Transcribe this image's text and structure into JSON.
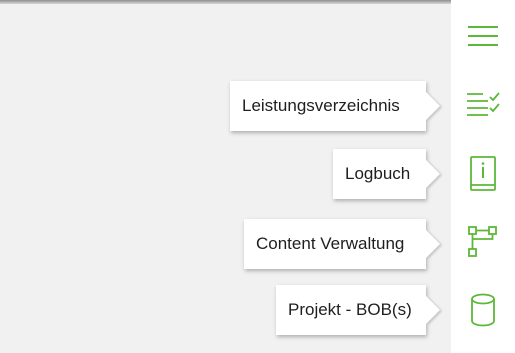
{
  "colors": {
    "accent": "#5cb83a",
    "background": "#f1f1f1",
    "panel": "#ffffff",
    "text": "#1e1e1e"
  },
  "sidebar": {
    "menu_icon": "hamburger-menu-icon",
    "items": [
      {
        "label": "Leistungsverzeichnis",
        "icon": "checklist-icon"
      },
      {
        "label": "Logbuch",
        "icon": "book-info-icon"
      },
      {
        "label": "Content Verwaltung",
        "icon": "hierarchy-icon"
      },
      {
        "label": "Projekt - BOB(s)",
        "icon": "database-icon"
      }
    ]
  }
}
